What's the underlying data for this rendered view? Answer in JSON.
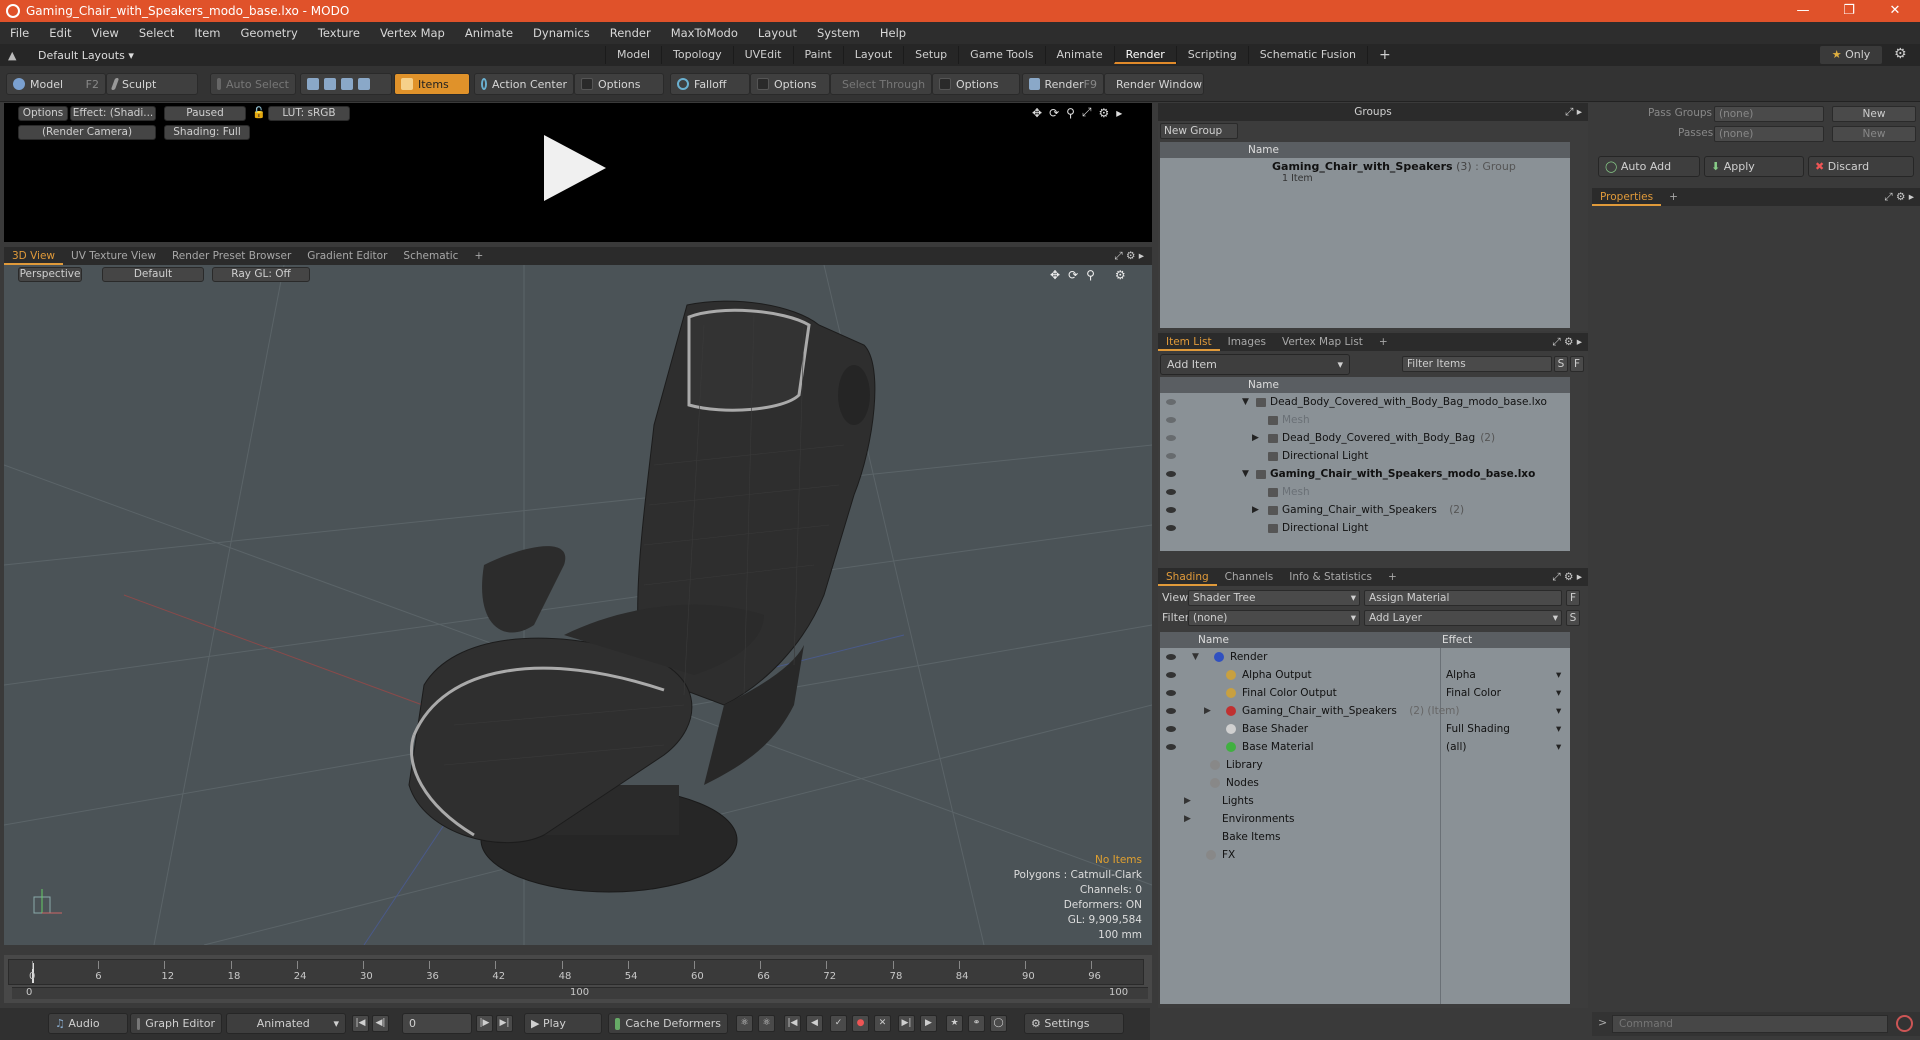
{
  "window": {
    "title": "Gaming_Chair_with_Speakers_modo_base.lxo - MODO"
  },
  "menu": [
    "File",
    "Edit",
    "View",
    "Select",
    "Item",
    "Geometry",
    "Texture",
    "Vertex Map",
    "Animate",
    "Dynamics",
    "Render",
    "MaxToModo",
    "Layout",
    "System",
    "Help"
  ],
  "layoutbar": {
    "layout_select": "Default Layouts",
    "tabs": [
      "Model",
      "Topology",
      "UVEdit",
      "Paint",
      "Layout",
      "Setup",
      "Game Tools",
      "Animate",
      "Render",
      "Scripting",
      "Schematic Fusion"
    ],
    "active_tab": "Render",
    "only_label": "Only"
  },
  "toolbar": {
    "model": "Model",
    "model_key": "F2",
    "sculpt": "Sculpt",
    "auto_select": "Auto Select",
    "items": "Items",
    "action_center": "Action Center",
    "options1": "Options",
    "falloff": "Falloff",
    "options2": "Options",
    "select_through": "Select Through",
    "options3": "Options",
    "render": "Render",
    "render_key": "F9",
    "render_window": "Render Window"
  },
  "render_preview": {
    "options": "Options",
    "effect": "Effect: (Shadi...",
    "paused": "Paused",
    "lut": "LUT: sRGB",
    "camera": "(Render Camera)",
    "shading": "Shading: Full"
  },
  "viewport_tabs": {
    "tabs": [
      "3D View",
      "UV Texture View",
      "Render Preset Browser",
      "Gradient Editor",
      "Schematic"
    ],
    "active": "3D View"
  },
  "viewport": {
    "perspective": "Perspective",
    "default": "Default",
    "raygl": "Ray GL: Off",
    "stats": {
      "no_items": "No Items",
      "polygons": "Polygons : Catmull-Clark",
      "channels": "Channels: 0",
      "deformers": "Deformers: ON",
      "gl": "GL: 9,909,584",
      "unit": "100 mm"
    }
  },
  "timeline": {
    "frames": [
      "0",
      "6",
      "12",
      "18",
      "24",
      "30",
      "36",
      "42",
      "48",
      "54",
      "60",
      "66",
      "72",
      "78",
      "84",
      "90",
      "96"
    ],
    "start": "0",
    "end": "100",
    "mid": "100"
  },
  "bottombar": {
    "audio": "Audio",
    "graph_editor": "Graph Editor",
    "animated": "Animated",
    "frame": "0",
    "play": "Play",
    "cache": "Cache Deformers",
    "settings": "Settings"
  },
  "groups": {
    "title": "Groups",
    "new_group": "New Group",
    "col_name": "Name",
    "item_name": "Gaming_Chair_with_Speakers",
    "item_count": "(3)",
    "item_type": ": Group",
    "item_sub": "1 Item"
  },
  "pass": {
    "pass_groups": "Pass Groups",
    "passes": "Passes",
    "none1": "(none)",
    "none2": "(none)",
    "new1": "New",
    "new2": "New",
    "auto_add": "Auto Add",
    "apply": "Apply",
    "discard": "Discard",
    "properties": "Properties"
  },
  "itemlist": {
    "tabs": [
      "Item List",
      "Images",
      "Vertex Map List"
    ],
    "active": "Item List",
    "add_item": "Add Item",
    "filter": "Filter Items",
    "col_name": "Name",
    "rows": [
      {
        "label": "Dead_Body_Covered_with_Body_Bag_modo_base.lxo",
        "extra": "",
        "indent": 0,
        "bold": false
      },
      {
        "label": "Mesh",
        "extra": "",
        "indent": 1,
        "bold": false,
        "dim": true
      },
      {
        "label": "Dead_Body_Covered_with_Body_Bag",
        "extra": "(2)",
        "indent": 1,
        "bold": false
      },
      {
        "label": "Directional Light",
        "extra": "",
        "indent": 1,
        "bold": false
      },
      {
        "label": "Gaming_Chair_with_Speakers_modo_base.lxo",
        "extra": "",
        "indent": 0,
        "bold": true
      },
      {
        "label": "Mesh",
        "extra": "",
        "indent": 1,
        "bold": false,
        "dim": true
      },
      {
        "label": "Gaming_Chair_with_Speakers",
        "extra": "(2)",
        "indent": 1,
        "bold": false
      },
      {
        "label": "Directional Light",
        "extra": "",
        "indent": 1,
        "bold": false
      }
    ]
  },
  "shading": {
    "tabs": [
      "Shading",
      "Channels",
      "Info & Statistics"
    ],
    "active": "Shading",
    "view_label": "View",
    "view_value": "Shader Tree",
    "assign": "Assign Material",
    "filter_label": "Filter",
    "filter_value": "(none)",
    "add_layer": "Add Layer",
    "col_name": "Name",
    "col_effect": "Effect",
    "rows": [
      {
        "label": "Render",
        "effect": "",
        "indent": 0
      },
      {
        "label": "Alpha Output",
        "effect": "Alpha",
        "indent": 1
      },
      {
        "label": "Final Color Output",
        "effect": "Final Color",
        "indent": 1
      },
      {
        "label": "Gaming_Chair_with_Speakers",
        "extra": "(2) (Item)",
        "effect": "",
        "indent": 1
      },
      {
        "label": "Base Shader",
        "effect": "Full Shading",
        "indent": 1
      },
      {
        "label": "Base Material",
        "effect": "(all)",
        "indent": 1
      },
      {
        "label": "Library",
        "effect": "",
        "indent": 0
      },
      {
        "label": "Nodes",
        "effect": "",
        "indent": 0
      },
      {
        "label": "Lights",
        "effect": "",
        "indent": -1
      },
      {
        "label": "Environments",
        "effect": "",
        "indent": -1
      },
      {
        "label": "Bake Items",
        "effect": "",
        "indent": -1
      },
      {
        "label": "FX",
        "effect": "",
        "indent": -1
      }
    ]
  },
  "command": {
    "placeholder": "Command"
  },
  "colors": {
    "accent": "#e0922a",
    "title": "#e0522a"
  }
}
